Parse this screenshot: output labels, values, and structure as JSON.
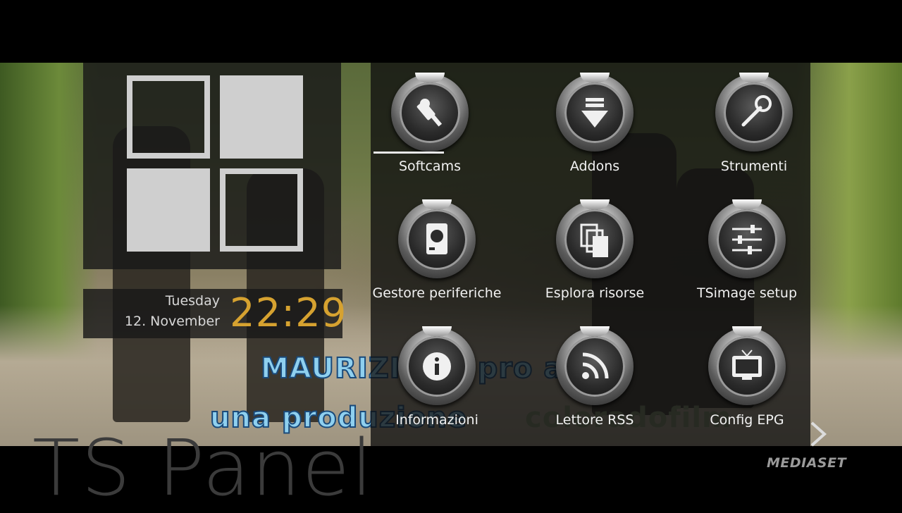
{
  "panel": {
    "title": "TS Panel"
  },
  "clock": {
    "day": "Tuesday",
    "date": "12. November",
    "time": "22:29"
  },
  "menu": {
    "items": [
      {
        "label": "Softcams",
        "icon": "softcam-icon",
        "selected": true
      },
      {
        "label": "Addons",
        "icon": "download-arrow-icon"
      },
      {
        "label": "Strumenti",
        "icon": "wrench-icon"
      },
      {
        "label": "Gestore periferiche",
        "icon": "hard-disk-icon"
      },
      {
        "label": "Esplora risorse",
        "icon": "files-icon"
      },
      {
        "label": "TSimage setup",
        "icon": "sliders-icon"
      },
      {
        "label": "Informazioni",
        "icon": "info-icon"
      },
      {
        "label": "Lettore RSS",
        "icon": "rss-icon"
      },
      {
        "label": "Config EPG",
        "icon": "tv-icon"
      }
    ]
  },
  "video": {
    "credit_line_1": "MAURIZIO   TI   pro    a",
    "credit_line_2": "una produzione",
    "credit_logo": "coloradofilm",
    "channel_logo": "MEDIASET"
  },
  "colors": {
    "clock_time": "#d6a230",
    "panel_bg": "#191919",
    "logo": "#cfcfcf"
  }
}
